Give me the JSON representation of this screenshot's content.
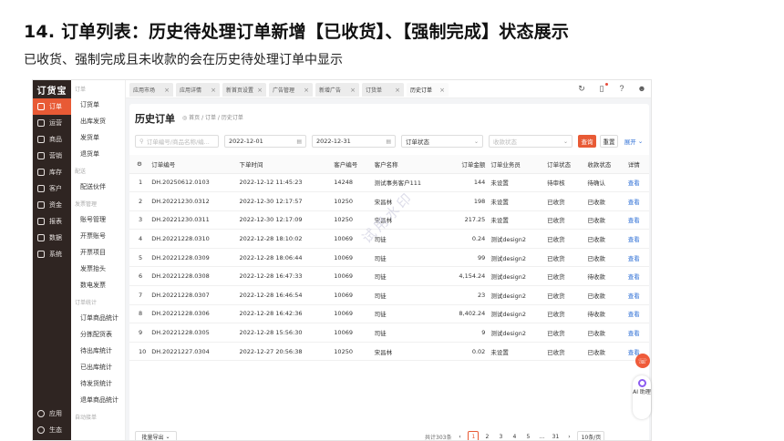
{
  "heading": "14. 订单列表：历史待处理订单新增【已收货】、【强制完成】状态展示",
  "subheading": "已收货、强制完成且未收款的会在历史待处理订单中显示",
  "app": {
    "logo": "订货宝",
    "sidebar": [
      {
        "label": "订单",
        "icon": "order-icon",
        "active": true
      },
      {
        "label": "运营",
        "icon": "operation-icon"
      },
      {
        "label": "商品",
        "icon": "goods-icon"
      },
      {
        "label": "营销",
        "icon": "marketing-icon"
      },
      {
        "label": "库存",
        "icon": "inventory-icon"
      },
      {
        "label": "客户",
        "icon": "customer-icon"
      },
      {
        "label": "资金",
        "icon": "funds-icon"
      },
      {
        "label": "报表",
        "icon": "report-icon"
      },
      {
        "label": "数据",
        "icon": "data-icon"
      },
      {
        "label": "系统",
        "icon": "system-icon"
      }
    ],
    "sidebar_bottom": [
      {
        "label": "应用",
        "icon": "apps-icon"
      },
      {
        "label": "生态",
        "icon": "ecosystem-icon"
      }
    ],
    "subnav": [
      {
        "type": "head",
        "label": "订单"
      },
      {
        "type": "item",
        "label": "订货单"
      },
      {
        "type": "item",
        "label": "出库发货"
      },
      {
        "type": "item",
        "label": "发货单"
      },
      {
        "type": "item",
        "label": "退货单"
      },
      {
        "type": "head",
        "label": "配送"
      },
      {
        "type": "item",
        "label": "配送伙伴"
      },
      {
        "type": "head",
        "label": "发票管理"
      },
      {
        "type": "item",
        "label": "账号管理"
      },
      {
        "type": "item",
        "label": "开票账号"
      },
      {
        "type": "item",
        "label": "开票项目"
      },
      {
        "type": "item",
        "label": "发票抬头"
      },
      {
        "type": "item",
        "label": "数电发票"
      },
      {
        "type": "head",
        "label": "订单统计"
      },
      {
        "type": "item",
        "label": "订单商品统计"
      },
      {
        "type": "item",
        "label": "分拣配货表"
      },
      {
        "type": "item",
        "label": "待出库统计"
      },
      {
        "type": "item",
        "label": "已出库统计"
      },
      {
        "type": "item",
        "label": "待发货统计"
      },
      {
        "type": "item",
        "label": "退单商品统计"
      },
      {
        "type": "head",
        "label": "自动接单"
      }
    ],
    "tabs": [
      "应用市场",
      "应用详情",
      "新首页设置",
      "广告管理",
      "新增广告",
      "订货单",
      "历史订单"
    ],
    "active_tab": 6,
    "page_title": "历史订单",
    "breadcrumb": "首页 / 订单 / 历史订单",
    "filters": {
      "search_placeholder": "订单编号/商品名称/编...",
      "date_start": "2022-12-01",
      "date_end": "2022-12-31",
      "order_status": "订单状态",
      "receipt_status": "收款状态",
      "query_label": "查询",
      "reset_label": "重置",
      "expand_label": "展开"
    },
    "table": {
      "columns": [
        "",
        "订单编号",
        "下单时间",
        "客户编号",
        "客户名称",
        "订单金额",
        "订单业务员",
        "订单状态",
        "收款状态",
        "详情"
      ],
      "rows": [
        [
          "1",
          "DH.20250612.0103",
          "2022-12-12 11:45:23",
          "14248",
          "测试事务客户111",
          "144",
          "未设置",
          "待审核",
          "待确认",
          "查看"
        ],
        [
          "2",
          "DH.20221230.0312",
          "2022-12-30 12:17:57",
          "10250",
          "宋昌林",
          "198",
          "未设置",
          "已收货",
          "已收款",
          "查看"
        ],
        [
          "3",
          "DH.20221230.0311",
          "2022-12-30 12:17:09",
          "10250",
          "宋昌林",
          "217.25",
          "未设置",
          "已收货",
          "已收款",
          "查看"
        ],
        [
          "4",
          "DH.20221228.0310",
          "2022-12-28 18:10:02",
          "10069",
          "司徒",
          "0.24",
          "测试design2",
          "已收货",
          "已收款",
          "查看"
        ],
        [
          "5",
          "DH.20221228.0309",
          "2022-12-28 18:06:44",
          "10069",
          "司徒",
          "99",
          "测试design2",
          "已收货",
          "已收款",
          "查看"
        ],
        [
          "6",
          "DH.20221228.0308",
          "2022-12-28 16:47:33",
          "10069",
          "司徒",
          "4,154.24",
          "测试design2",
          "已收货",
          "待收款",
          "查看"
        ],
        [
          "7",
          "DH.20221228.0307",
          "2022-12-28 16:46:54",
          "10069",
          "司徒",
          "23",
          "测试design2",
          "已收货",
          "已收款",
          "查看"
        ],
        [
          "8",
          "DH.20221228.0306",
          "2022-12-28 16:42:36",
          "10069",
          "司徒",
          "8,402.24",
          "测试design2",
          "已收货",
          "待收款",
          "查看"
        ],
        [
          "9",
          "DH.20221228.0305",
          "2022-12-28 15:56:30",
          "10069",
          "司徒",
          "9",
          "测试design2",
          "已收货",
          "已收款",
          "查看"
        ],
        [
          "10",
          "DH.20221227.0304",
          "2022-12-27 20:56:38",
          "10250",
          "宋昌林",
          "0.02",
          "未设置",
          "已收货",
          "已收款",
          "查看"
        ]
      ]
    },
    "footer": {
      "export_label": "批量导出",
      "total": "共计303条",
      "pages": [
        "1",
        "2",
        "3",
        "4",
        "5",
        "...",
        "31"
      ],
      "current_page": "1",
      "page_size": "10条/页"
    },
    "watermark": "试用水印",
    "ai_label": "AI 助理",
    "colors": {
      "accent": "#e85a35",
      "sidebar": "#2f2522",
      "link": "#2e6fd6"
    }
  }
}
